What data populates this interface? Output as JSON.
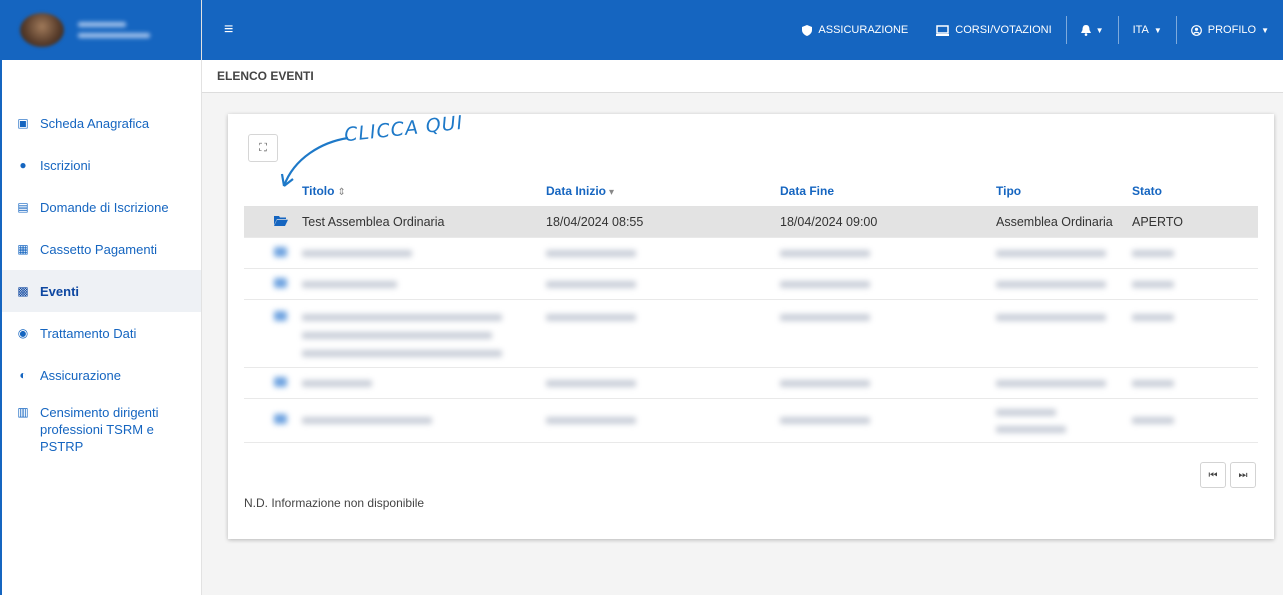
{
  "sidebar": {
    "items": [
      {
        "label": "Scheda Anagrafica",
        "icon": "id-card-icon",
        "glyph": "▣"
      },
      {
        "label": "Iscrizioni",
        "icon": "user-icon",
        "glyph": "●"
      },
      {
        "label": "Domande di Iscrizione",
        "icon": "form-icon",
        "glyph": "▤"
      },
      {
        "label": "Cassetto Pagamenti",
        "icon": "document-icon",
        "glyph": "▦"
      },
      {
        "label": "Eventi",
        "icon": "calendar-icon",
        "glyph": "▩"
      },
      {
        "label": "Trattamento Dati",
        "icon": "eye-icon",
        "glyph": "◉"
      },
      {
        "label": "Assicurazione",
        "icon": "shield-icon",
        "glyph": "◐"
      },
      {
        "label": "Censimento dirigenti professioni TSRM e PSTRP",
        "icon": "clipboard-icon",
        "glyph": "▥"
      }
    ]
  },
  "topbar": {
    "menu_glyph": "≡",
    "assicurazione": "ASSICURAZIONE",
    "corsi": "CORSI/VOTAZIONI",
    "lang": "ITA",
    "profilo": "PROFILO"
  },
  "breadcrumb": "ELENCO EVENTI",
  "annotation": "CLICCA QUI",
  "table": {
    "headers": {
      "titolo": "Titolo",
      "data_inizio": "Data Inizio",
      "data_fine": "Data Fine",
      "tipo": "Tipo",
      "stato": "Stato"
    },
    "row0": {
      "titolo": "Test Assemblea Ordinaria",
      "data_inizio": "18/04/2024 08:55",
      "data_fine": "18/04/2024 09:00",
      "tipo": "Assemblea Ordinaria",
      "stato": "APERTO"
    }
  },
  "footer_note": "N.D. Informazione non disponibile",
  "colors": {
    "brand": "#1565c0",
    "selected_row": "#e3e3e3"
  }
}
